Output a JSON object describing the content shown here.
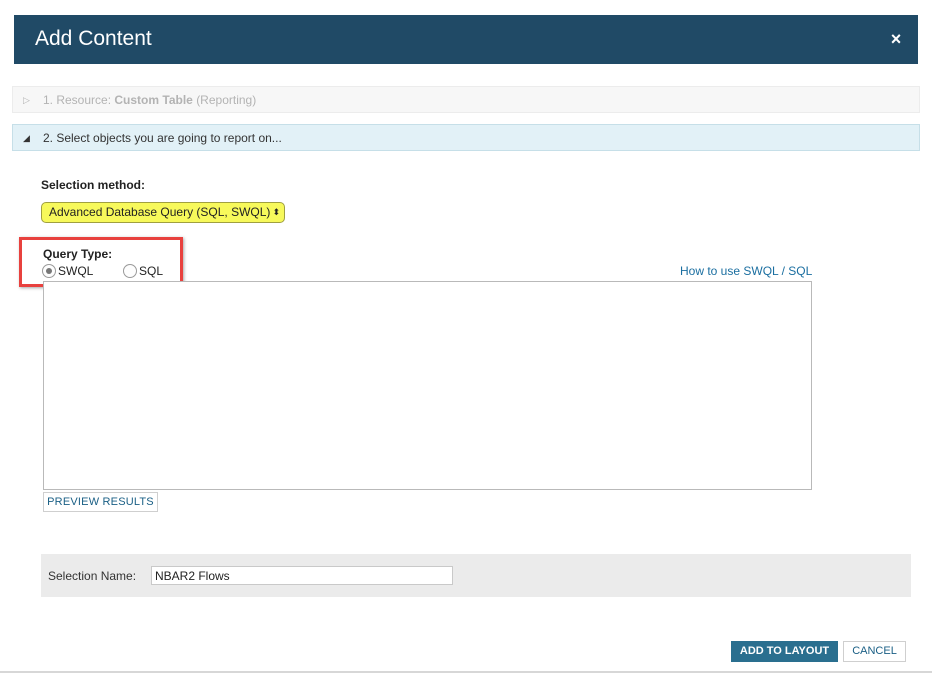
{
  "dialog": {
    "title": "Add Content",
    "close_symbol": "×"
  },
  "steps": [
    {
      "number": "1. Resource:",
      "name": "Custom Table",
      "detail": "(Reporting)",
      "state": "collapsed",
      "arrow": "▷"
    },
    {
      "label": "2. Select objects you are going to report on...",
      "state": "expanded",
      "arrow": "◢"
    }
  ],
  "selection_method": {
    "label": "Selection method:",
    "selected": "Advanced Database Query (SQL, SWQL)",
    "arrow": "⬍",
    "highlight_color": "#f7f95b"
  },
  "query_type": {
    "label": "Query Type:",
    "options": [
      {
        "label": "SWQL",
        "selected": true
      },
      {
        "label": "SQL",
        "selected": false
      }
    ],
    "highlight_border_color": "#e8413e"
  },
  "help_link": "How to use SWQL / SQL",
  "query_text": "",
  "preview_button": "PREVIEW RESULTS",
  "selection_name": {
    "label": "Selection Name:",
    "value": "NBAR2 Flows"
  },
  "footer": {
    "add_button": "ADD TO LAYOUT",
    "cancel_button": "CANCEL"
  },
  "colors": {
    "title_bar": "#204a66",
    "accent_button": "#2a6f8f",
    "link": "#1a6ea0"
  }
}
